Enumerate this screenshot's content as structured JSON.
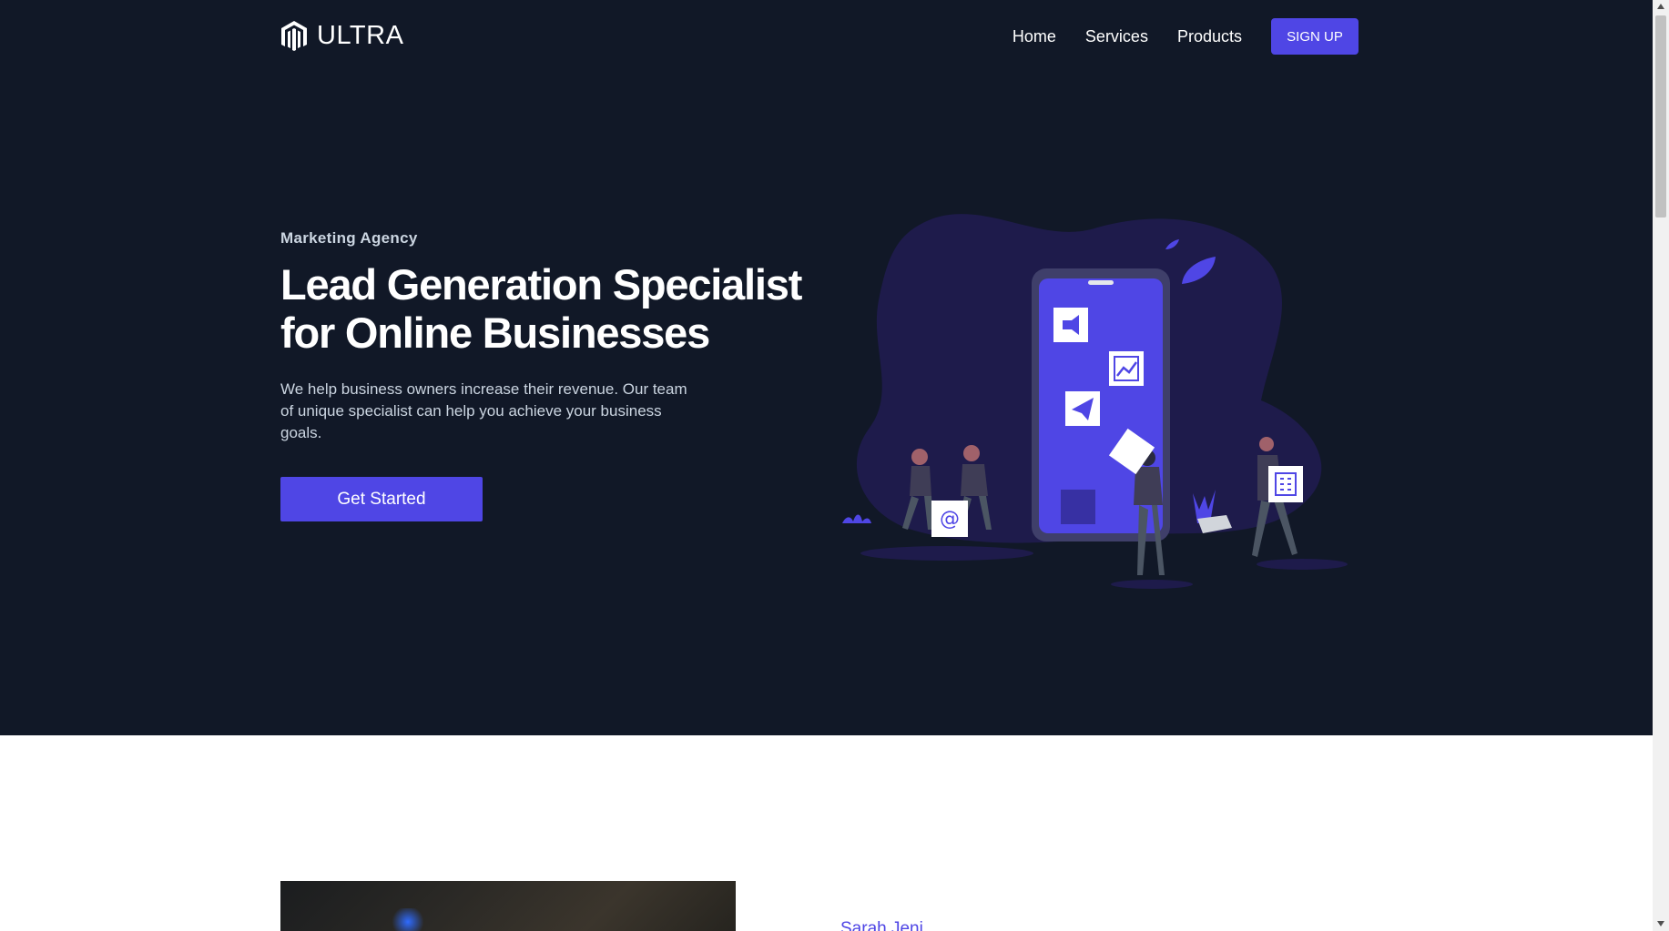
{
  "brand": {
    "name": "ULTRA"
  },
  "nav": {
    "links": [
      "Home",
      "Services",
      "Products"
    ],
    "signup_label": "SIGN UP"
  },
  "hero": {
    "eyebrow": "Marketing Agency",
    "headline": "Lead Generation Specialist for Online Businesses",
    "description": "We help business owners increase their revenue. Our team of unique specialist can help you achieve your business goals.",
    "cta_label": "Get Started",
    "illustration": {
      "icons": [
        "megaphone-icon",
        "chart-icon",
        "paper-plane-icon",
        "at-sign-icon",
        "building-icon"
      ]
    }
  },
  "next_section": {
    "author_name": "Sarah Jeni"
  },
  "colors": {
    "hero_bg": "#111827",
    "accent": "#4f46e5",
    "text_muted": "#cbd5e1"
  }
}
